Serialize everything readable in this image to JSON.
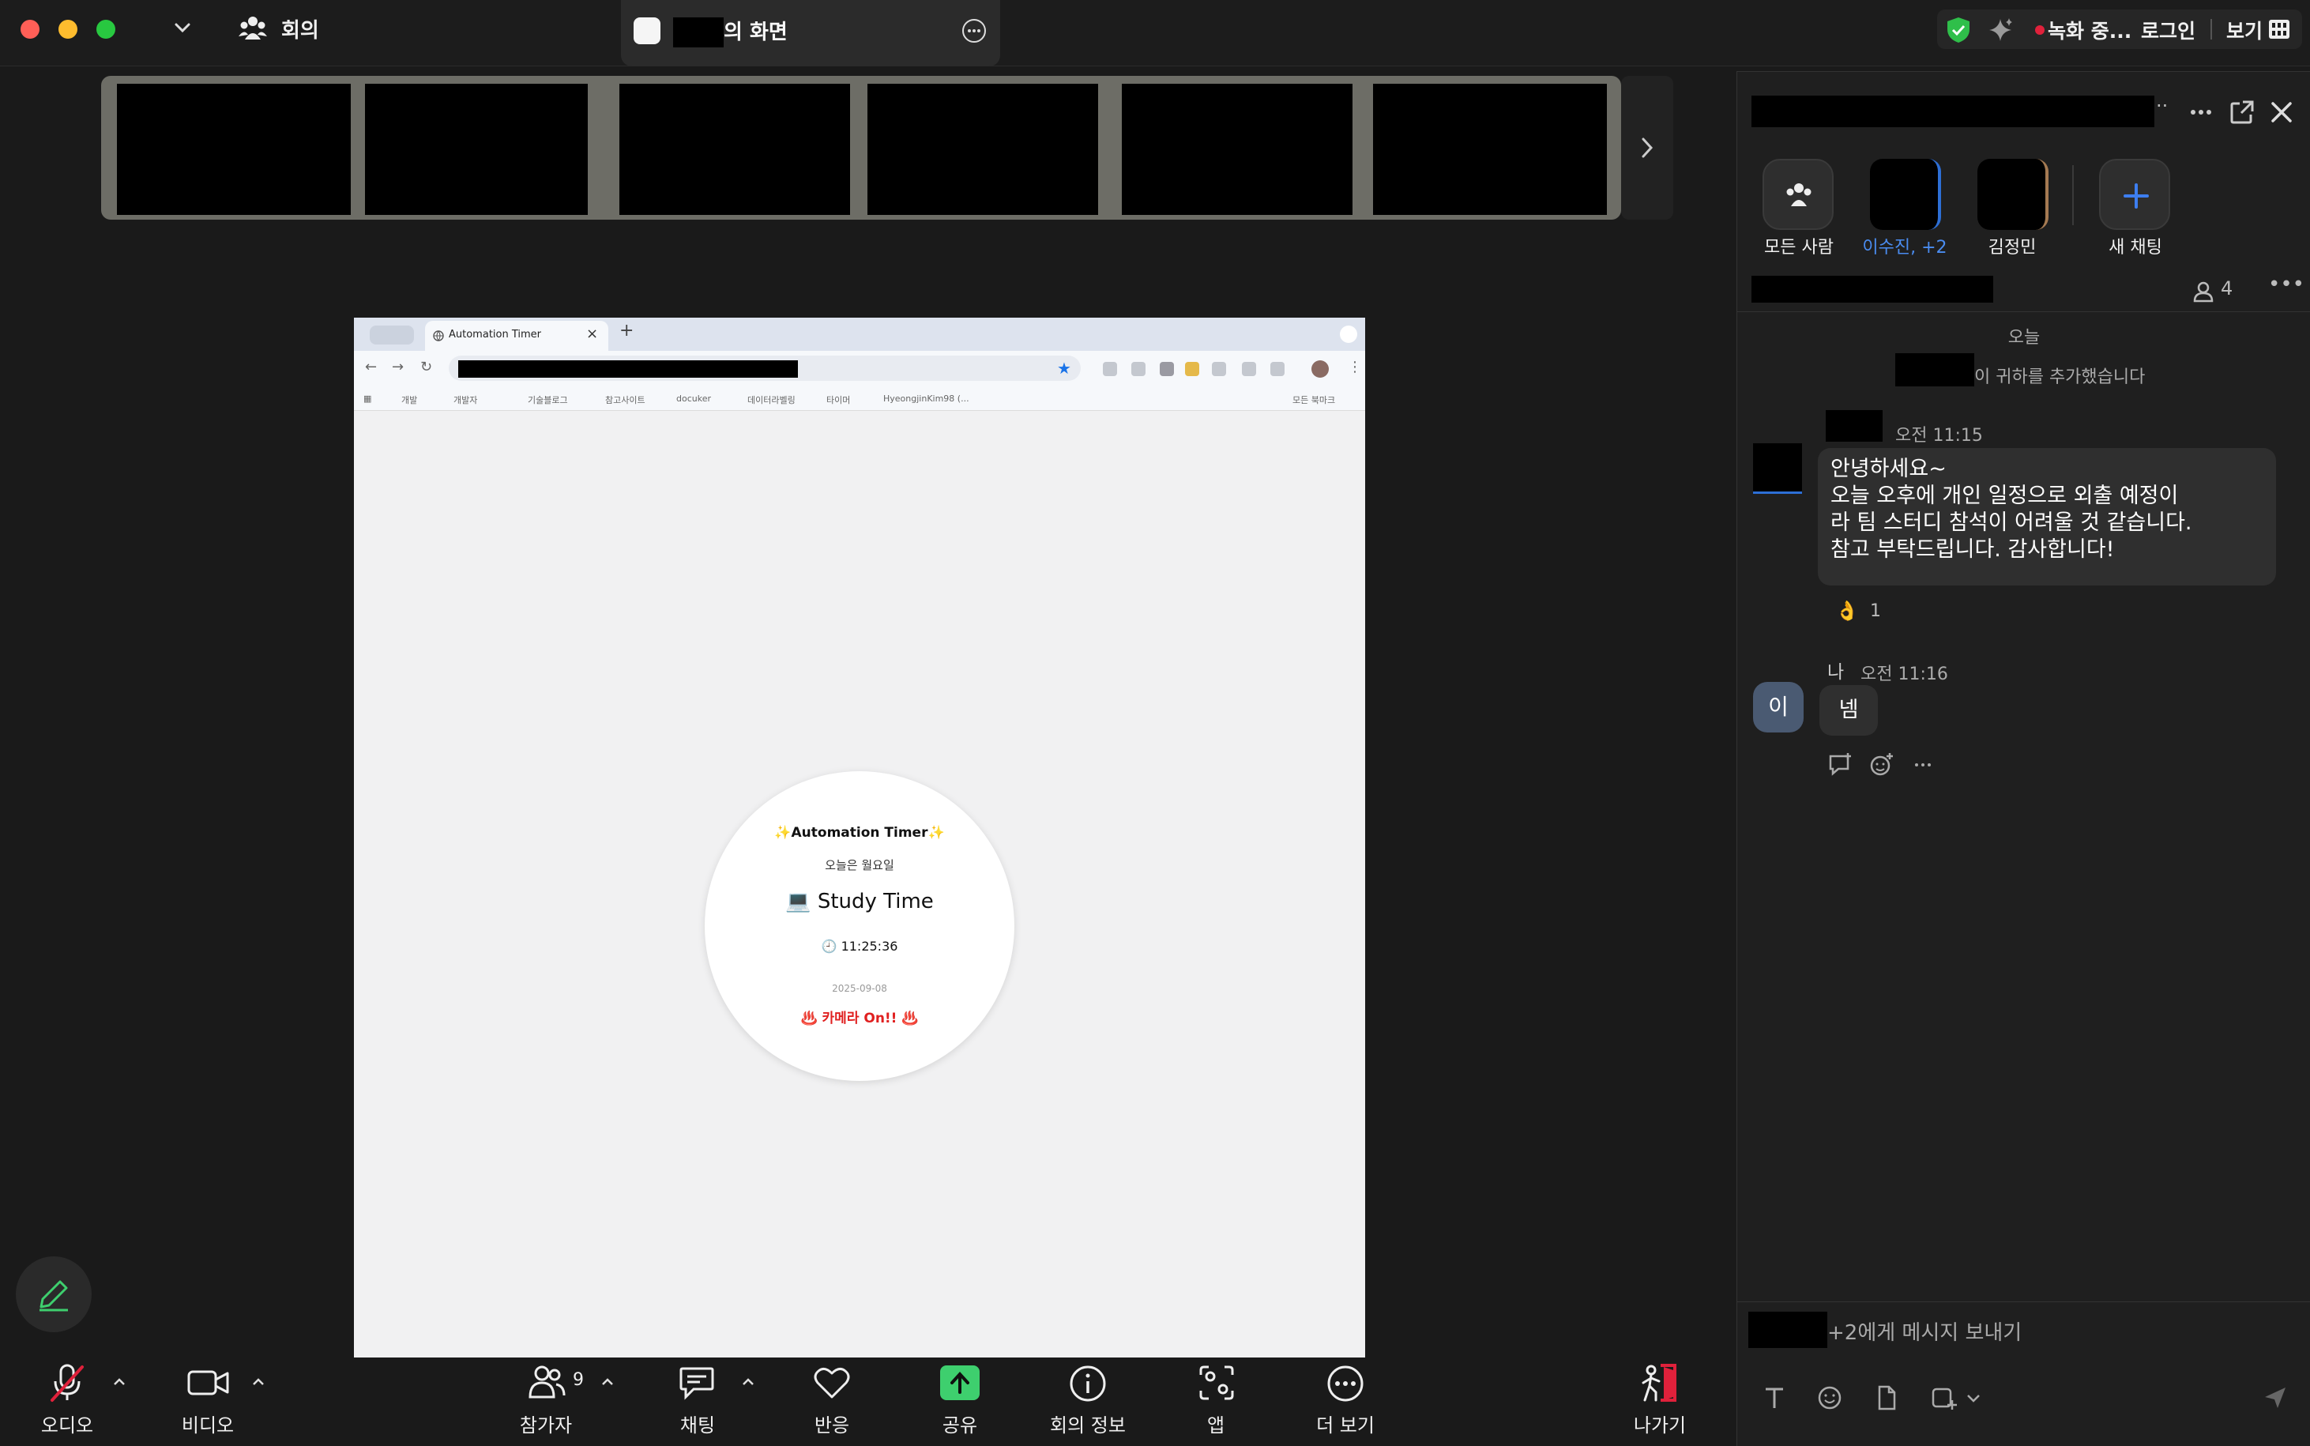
{
  "topbar": {
    "meeting_title": "회의",
    "share_tab_label": "의 화면",
    "recording_label": "녹화 중...",
    "login_label": "로그인",
    "view_label": "보기"
  },
  "browser": {
    "tab_title": "Automation Timer",
    "bookmarks": [
      "개발",
      "개발자",
      "기술블로그",
      "참고사이트",
      "docuker",
      "데이터라벨링",
      "타이머",
      "HyeongjinKim98 (...",
      "모든 북마크"
    ]
  },
  "timer": {
    "title": "✨Automation Timer✨",
    "day_text": "오늘은 월요일",
    "mode": "💻 Study Time",
    "clock": "🕘 11:25:36",
    "date": "2025-09-08",
    "camera": "♨️ 카메라 On!! ♨️"
  },
  "toolbar": {
    "audio": "오디오",
    "video": "비디오",
    "participants": "참가자",
    "participant_count": "9",
    "chat": "채팅",
    "reactions": "반응",
    "share": "공유",
    "meeting_info": "회의 정보",
    "apps": "앱",
    "more": "더 보기",
    "leave": "나가기"
  },
  "panel": {
    "channels": [
      {
        "label": "모든 사람"
      },
      {
        "label": "이수진, +2"
      },
      {
        "label": "김정민"
      },
      {
        "label": "새 채팅"
      }
    ],
    "member_count": "4",
    "day_label": "오늘",
    "added_text": "이 귀하를 추가했습니다",
    "messages": [
      {
        "time": "오전 11:15",
        "lines": [
          "안녕하세요~",
          "오늘 오후에 개인 일정으로 외출 예정이",
          "라 팀 스터디 참석이 어려울 것 같습니다.",
          "참고 부탁드립니다. 감사합니다!"
        ],
        "reaction_emoji": "👌",
        "reaction_count": "1"
      },
      {
        "sender": "나",
        "time": "오전 11:16",
        "avatar_initial": "이",
        "text": "넴"
      }
    ],
    "composer_placeholder": "+2에게 메시지 보내기"
  },
  "colors": {
    "recording": "#e0213b",
    "share_green": "#3ecf6e",
    "leave_red": "#e0213b",
    "accent_blue": "#2d6fd6",
    "shield_green": "#2fbf4a"
  }
}
